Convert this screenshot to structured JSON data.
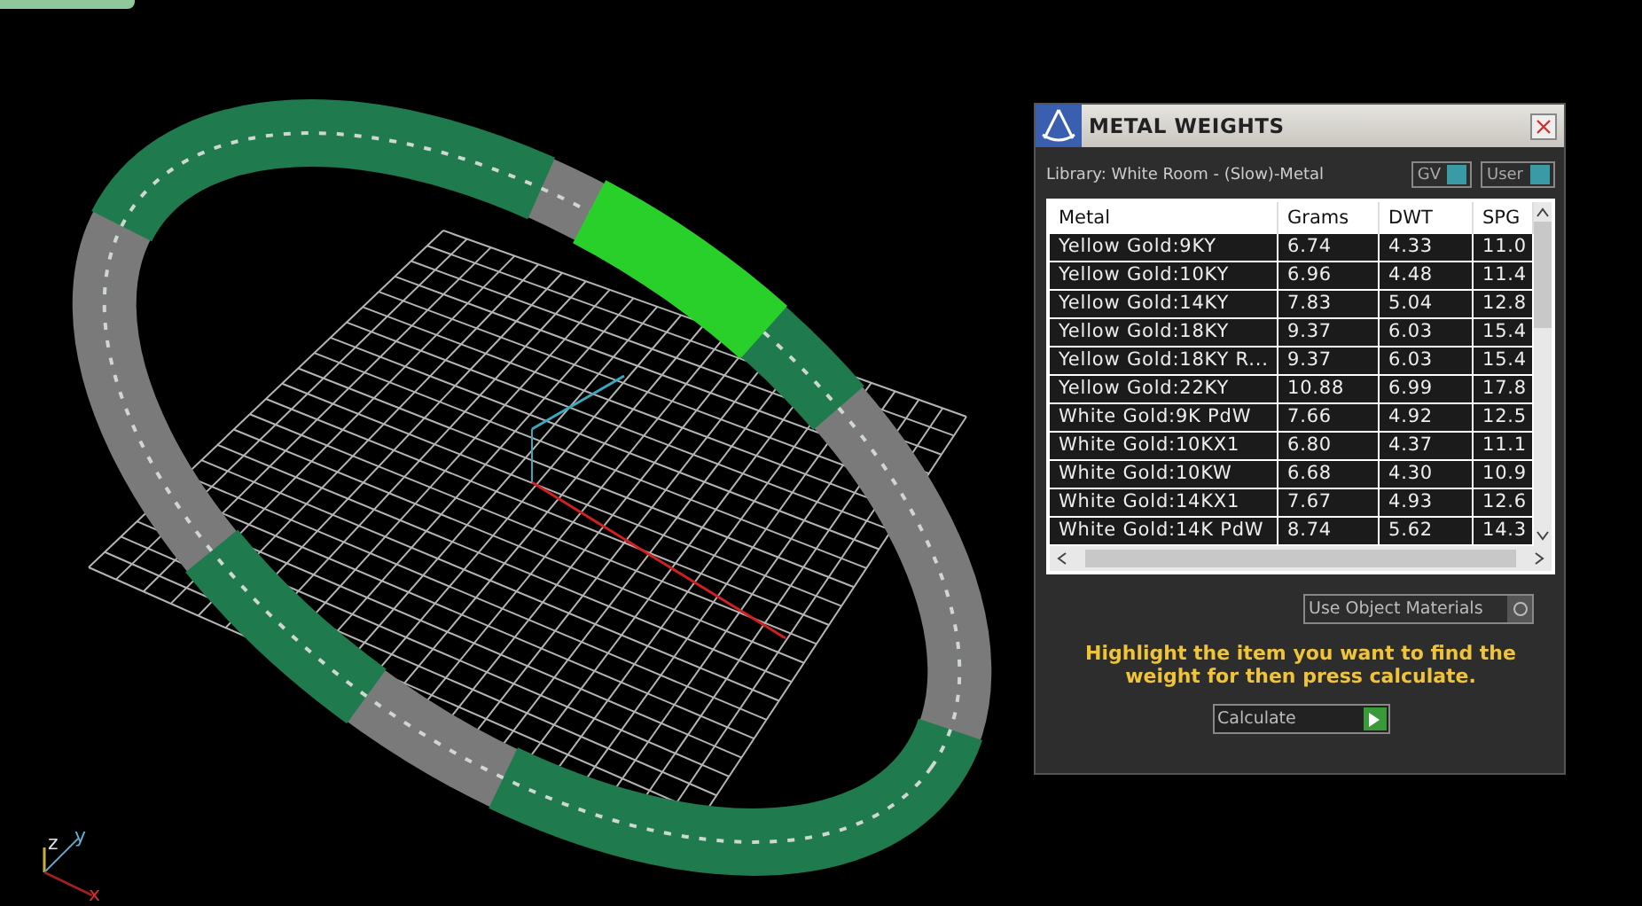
{
  "viewport": {
    "axis_labels": [
      "z",
      "y",
      "x"
    ]
  },
  "dialog": {
    "title": "METAL WEIGHTS",
    "library": "Library: White Room - (Slow)-Metal",
    "toggles": [
      {
        "label": "GV",
        "on": true
      },
      {
        "label": "User",
        "on": true
      }
    ],
    "table": {
      "columns": [
        "Metal",
        "Grams",
        "DWT",
        "SPG"
      ],
      "rows": [
        [
          "Yellow Gold:9KY",
          "6.74",
          "4.33",
          "11.0"
        ],
        [
          "Yellow Gold:10KY",
          "6.96",
          "4.48",
          "11.4"
        ],
        [
          "Yellow Gold:14KY",
          "7.83",
          "5.04",
          "12.8"
        ],
        [
          "Yellow Gold:18KY",
          "9.37",
          "6.03",
          "15.4"
        ],
        [
          "Yellow Gold:18KY R...",
          "9.37",
          "6.03",
          "15.4"
        ],
        [
          "Yellow Gold:22KY",
          "10.88",
          "6.99",
          "17.8"
        ],
        [
          "White Gold:9K PdW",
          "7.66",
          "4.92",
          "12.5"
        ],
        [
          "White Gold:10KX1",
          "6.80",
          "4.37",
          "11.1"
        ],
        [
          "White Gold:10KW",
          "6.68",
          "4.30",
          "10.9"
        ],
        [
          "White Gold:14KX1",
          "7.67",
          "4.93",
          "12.6"
        ],
        [
          "White Gold:14K PdW",
          "8.74",
          "5.62",
          "14.3"
        ]
      ]
    },
    "materials_dropdown": {
      "value": "Use Object Materials"
    },
    "hint": "Highlight the item you want to find the weight for then press calculate.",
    "calculate_button": "Calculate"
  }
}
